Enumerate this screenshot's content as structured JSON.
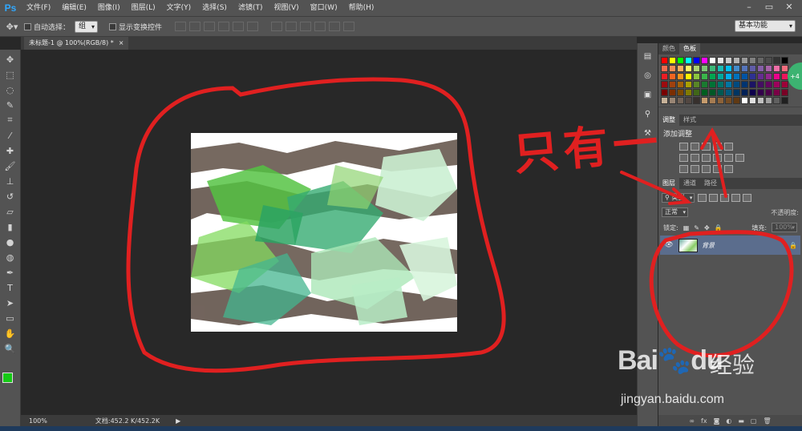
{
  "app": {
    "logo": "Ps"
  },
  "menu": [
    "文件(F)",
    "编辑(E)",
    "图像(I)",
    "图层(L)",
    "文字(Y)",
    "选择(S)",
    "滤镜(T)",
    "视图(V)",
    "窗口(W)",
    "帮助(H)"
  ],
  "options": {
    "auto_select_label": "自动选择：",
    "auto_select_value": "组",
    "show_transform_label": "显示变换控件",
    "workspace": "基本功能"
  },
  "document": {
    "tab_title": "未标题-1 @ 100%(RGB/8) *",
    "close": "×"
  },
  "status": {
    "zoom": "100%",
    "doc_info": "文档:452.2 K/452.2K"
  },
  "panels": {
    "tab_color": "颜色",
    "tab_swatches": "色板",
    "tab_adjust": "调整",
    "tab_styles": "样式",
    "add_adjustment": "添加调整",
    "tab_layers": "图层",
    "tab_channels": "通道",
    "tab_paths": "路径",
    "filter_type": "类型",
    "blend_mode": "正常",
    "opacity_label": "不透明度:",
    "lock_label": "锁定:",
    "fill_label": "填充:",
    "fill_value": "100%",
    "layer_name": "背景"
  },
  "annotation": {
    "text": "只有一"
  },
  "watermark": {
    "logo": "Bai",
    "logo2": "du",
    "cn": "经验",
    "url": "jingyan.baidu.com"
  },
  "colors": {
    "accent_blue": "#31a8ff",
    "fg_color": "#15c915",
    "annotation_red": "#e02020",
    "layer_selected": "#5b6d8d"
  },
  "badge": "+4"
}
